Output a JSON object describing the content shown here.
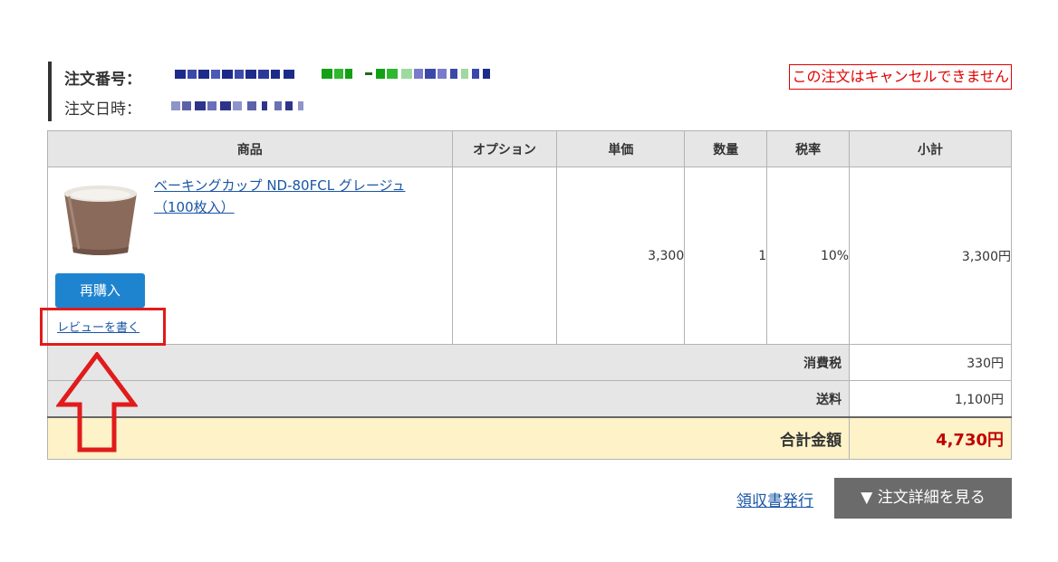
{
  "order": {
    "number_label": "注文番号：",
    "date_label": "注文日時：",
    "cancel_note": "この注文はキャンセルできません"
  },
  "table": {
    "headers": [
      "商品",
      "オプション",
      "単価",
      "数量",
      "税率",
      "小計"
    ],
    "item": {
      "name": "ベーキングカップ ND-80FCL グレージュ（100枚入）",
      "option": "",
      "unit_price": "3,300",
      "quantity": "1",
      "tax_rate": "10%",
      "subtotal": "3,300円",
      "rebuy_label": "再購入",
      "review_label": "レビューを書く"
    },
    "tax_label": "消費税",
    "tax_value": "330円",
    "shipping_label": "送料",
    "shipping_value": "1,100円",
    "total_label": "合計金額",
    "total_value": "4,730円"
  },
  "footer": {
    "receipt_label": "領収書発行",
    "detail_label": "▼ 注文詳細を見る"
  },
  "colors": {
    "link": "#1a56a6",
    "rebuy_button": "#1f84cf",
    "detail_button": "#6b6b6b",
    "cancel_note": "#e00000",
    "total_value": "#c00000",
    "total_row_bg": "#fdf2c8",
    "highlight": "#e11b1b"
  },
  "icons": {
    "product_image": "baking-cup-image",
    "annotation_arrow": "up-arrow-icon"
  }
}
